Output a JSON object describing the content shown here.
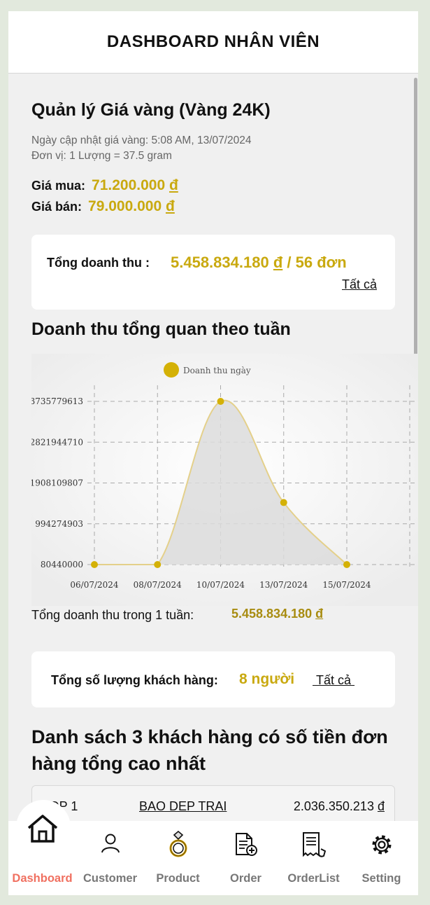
{
  "header": {
    "title": "DASHBOARD NHÂN VIÊN"
  },
  "gold": {
    "title": "Quản lý Giá vàng (Vàng 24K)",
    "updated": "Ngày cập nhật giá vàng: 5:08 AM, 13/07/2024",
    "unit": "Đơn vị: 1 Lượng = 37.5 gram",
    "buy_label": "Giá mua:",
    "buy_value": "71.200.000",
    "sell_label": "Giá bán:",
    "sell_value": "79.000.000",
    "currency": "đ"
  },
  "revenue_card": {
    "label": "Tổng doanh thu :",
    "value": "5.458.834.180",
    "currency": "đ",
    "orders": "/ 56 đơn",
    "link": "Tất cả"
  },
  "weekly": {
    "title": "Doanh thu tổng quan theo tuần",
    "total_label": "Tổng doanh thu trong 1 tuần:",
    "total_value": "5.458.834.180",
    "currency": "đ"
  },
  "chart_data": {
    "type": "area",
    "legend": [
      "Doanh thu ngày"
    ],
    "legend_position": "top-center",
    "x": [
      "06/07/2024",
      "08/07/2024",
      "10/07/2024",
      "13/07/2024",
      "15/07/2024"
    ],
    "series": [
      {
        "name": "Doanh thu ngày",
        "values": [
          0,
          0,
          3735779613,
          1470000000,
          80440000
        ]
      }
    ],
    "y_ticks": [
      "80440000",
      "994274903",
      "1908109807",
      "2821944710",
      "3735779613"
    ],
    "ylim": [
      80440000,
      3735779613
    ],
    "grid": true,
    "colors": {
      "line": "#e4d08a",
      "fill": "#dcdcdc",
      "point": "#d4b106",
      "grid": "#aaaaaa"
    }
  },
  "customers_card": {
    "label": "Tổng số lượng khách hàng:",
    "value": "8 người",
    "link": "Tất cả"
  },
  "top_customers": {
    "title": "Danh sách 3 khách hàng có số tiền đơn hàng tổng cao nhất",
    "rows": [
      {
        "rank": "TOP 1",
        "name": "BAO DEP TRAI",
        "amount": "2.036.350.213",
        "currency": "đ"
      }
    ]
  },
  "nav": {
    "items": [
      {
        "label": "Dashboard",
        "icon": "home-icon",
        "active": true
      },
      {
        "label": "Customer",
        "icon": "user-icon",
        "active": false
      },
      {
        "label": "Product",
        "icon": "ring-icon",
        "active": false
      },
      {
        "label": "Order",
        "icon": "document-add-icon",
        "active": false
      },
      {
        "label": "OrderList",
        "icon": "receipt-icon",
        "active": false
      },
      {
        "label": "Setting",
        "icon": "gear-icon",
        "active": false
      }
    ]
  },
  "colors": {
    "accent": "#c9a90f",
    "active_nav": "#f07060",
    "background": "#e2e9dd"
  }
}
